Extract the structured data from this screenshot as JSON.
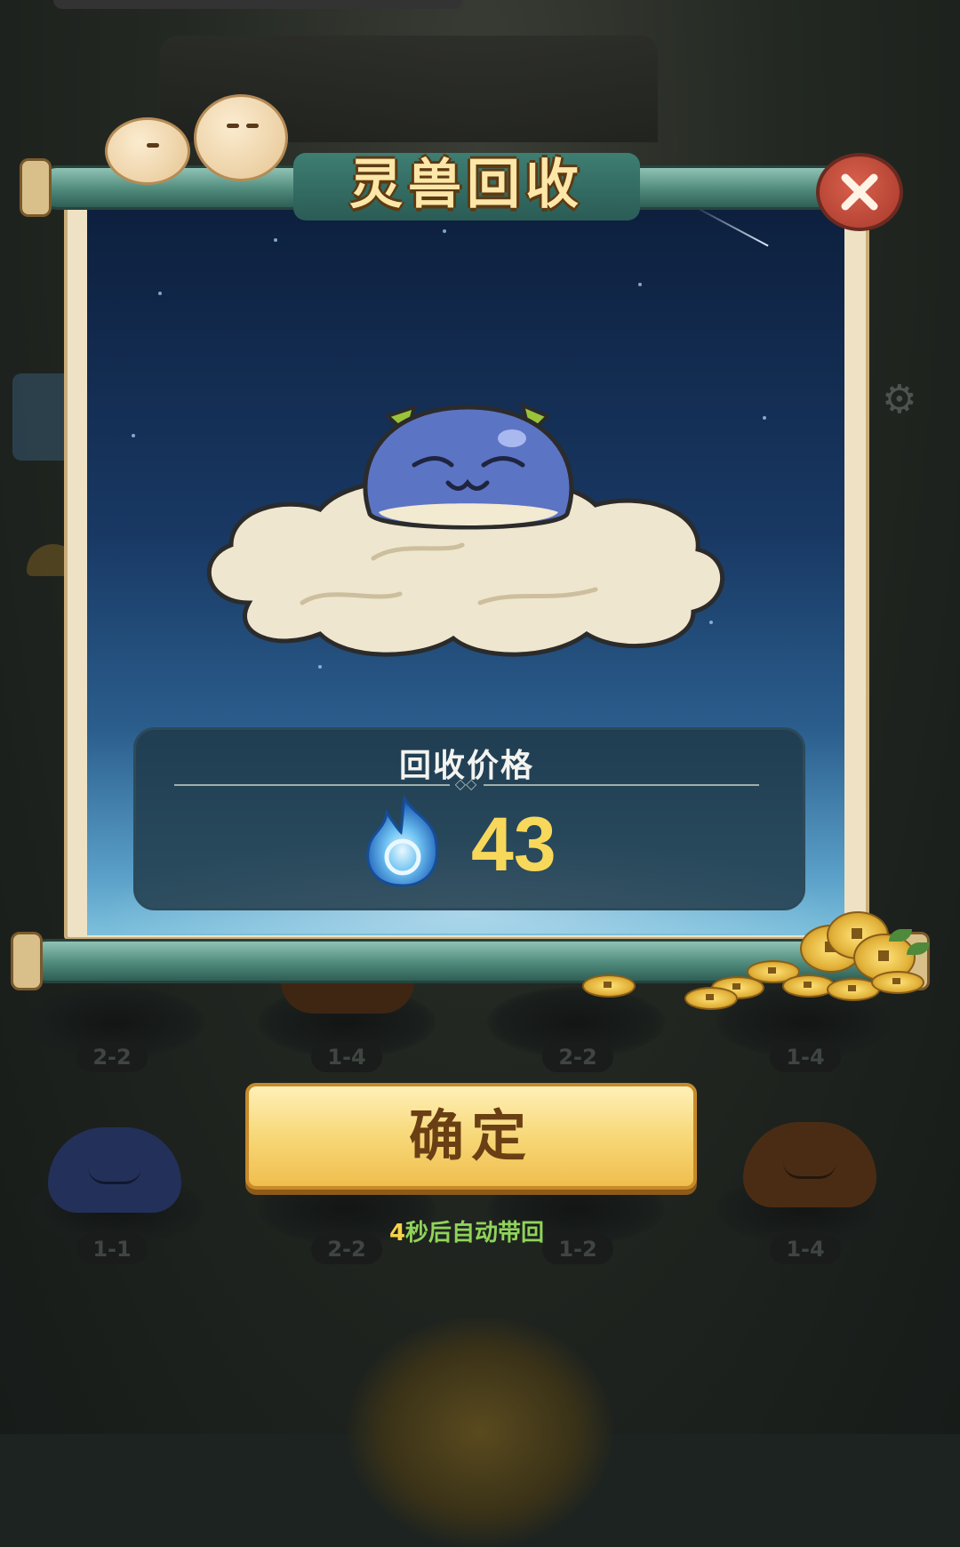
{
  "dialog": {
    "title": "灵兽回收",
    "close_icon": "close-icon",
    "pet_icon": "blue-slime-pet-icon",
    "price_section": {
      "label": "回收价格",
      "currency_icon": "blue-spirit-flame-icon",
      "value": "43"
    },
    "confirm_label": "确定",
    "auto_return": {
      "seconds": "4",
      "suffix": "秒后自动带回"
    }
  },
  "background": {
    "slot_labels_row1": [
      "2-2",
      "1-4",
      "2-2",
      "1-4"
    ],
    "slot_labels_row2": [
      "1-1",
      "2-2",
      "1-2",
      "1-4"
    ],
    "settings_icon": "gear-icon"
  },
  "colors": {
    "accent_gold": "#f7d85a",
    "confirm_button": "#f7d878",
    "close_button": "#c04a38",
    "auto_return_text": "#8fd45a"
  }
}
